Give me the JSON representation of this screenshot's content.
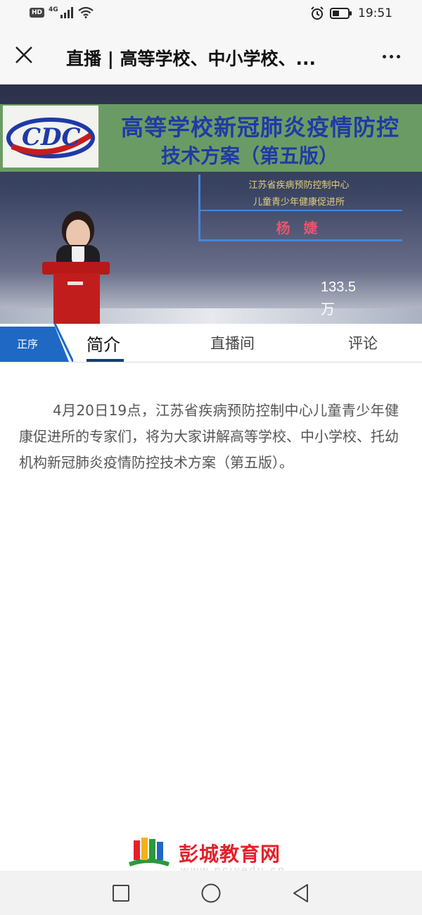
{
  "status_bar": {
    "network_badge": "HD",
    "network_type": "4G",
    "time": "19:51",
    "icons": [
      "hd-icon",
      "signal-icon",
      "wifi-icon",
      "alarm-icon",
      "battery-icon"
    ]
  },
  "header": {
    "title": "直播 | 高等学校、中小学校、...",
    "close_icon": "close-icon",
    "more_icon": "more-icon"
  },
  "video": {
    "banner_title_line1": "高等学校新冠肺炎疫情防控",
    "banner_title_line2": "技术方案（第五版）",
    "organization_line1": "江苏省疾病预防控制中心",
    "organization_line2": "儿童青少年健康促进所",
    "speaker": "杨 婕",
    "view_count": "133.5",
    "view_unit": "万"
  },
  "tabs": {
    "order_label": "正序",
    "items": [
      {
        "label": "简介",
        "active": true
      },
      {
        "label": "直播间",
        "active": false
      },
      {
        "label": "评论",
        "active": false
      }
    ]
  },
  "intro": {
    "text": "4月20日19点，江苏省疾病预防控制中心儿童青少年健康促进所的专家们，将为大家讲解高等学校、中小学校、托幼机构新冠肺炎疫情防控技术方案（第五版）。"
  },
  "watermark": {
    "site_name": "彭城教育网",
    "url": "www.pcjyedu.cn"
  },
  "nav_bar": {
    "icons": [
      "recent-apps-icon",
      "home-icon",
      "back-icon"
    ]
  },
  "colors": {
    "accent_blue": "#14406e",
    "order_badge_blue": "#1f68c4",
    "watermark_red": "#e5202a"
  }
}
